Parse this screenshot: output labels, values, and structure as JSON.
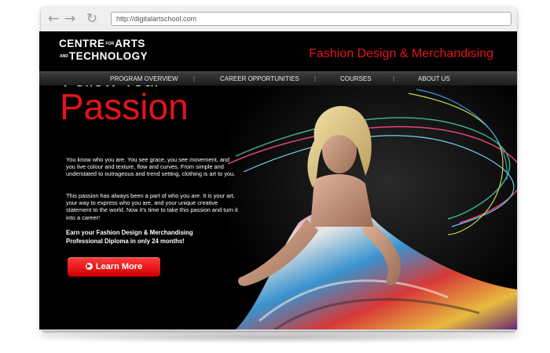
{
  "browser": {
    "back_icon": "back-arrow-icon",
    "forward_icon": "forward-arrow-icon",
    "reload_icon": "reload-icon",
    "address": "http://digitalartschool.com"
  },
  "site": {
    "logo": {
      "word_1": "CENTRE",
      "small_1": "FOR",
      "word_2": "ARTS",
      "small_2": "AND",
      "word_3": "TECHNOLOGY"
    },
    "program_title": "Fashion Design & Merchandising",
    "nav": [
      {
        "label": "PROGRAM OVERVIEW"
      },
      {
        "label": "CAREER OPPORTUNITIES"
      },
      {
        "label": "COURSES"
      },
      {
        "label": "ABOUT US"
      }
    ],
    "nav_separator": "|",
    "hero": {
      "headline_line_1": "Follow Your",
      "headline_line_2": "Passion",
      "paragraph_1": "You know who you are. You see grace, you see movement, and you live colour and texture, flow and curves. From simple and understated to outrageous and trend setting, clothing is art to you.",
      "paragraph_2": "This passion has always been a part of who you are.  It is your art, your way to express who you are, and your unique creative statement to the world. Now it's time to take this passion and turn it into a career!",
      "cta_text": "Earn your Fashion Design & Merchandising Professional Diploma in only 24 months!",
      "button_label": "Learn More",
      "button_icon": "arrow-circle-icon"
    }
  },
  "colors": {
    "accent": "#e3141b",
    "background": "#000000"
  }
}
